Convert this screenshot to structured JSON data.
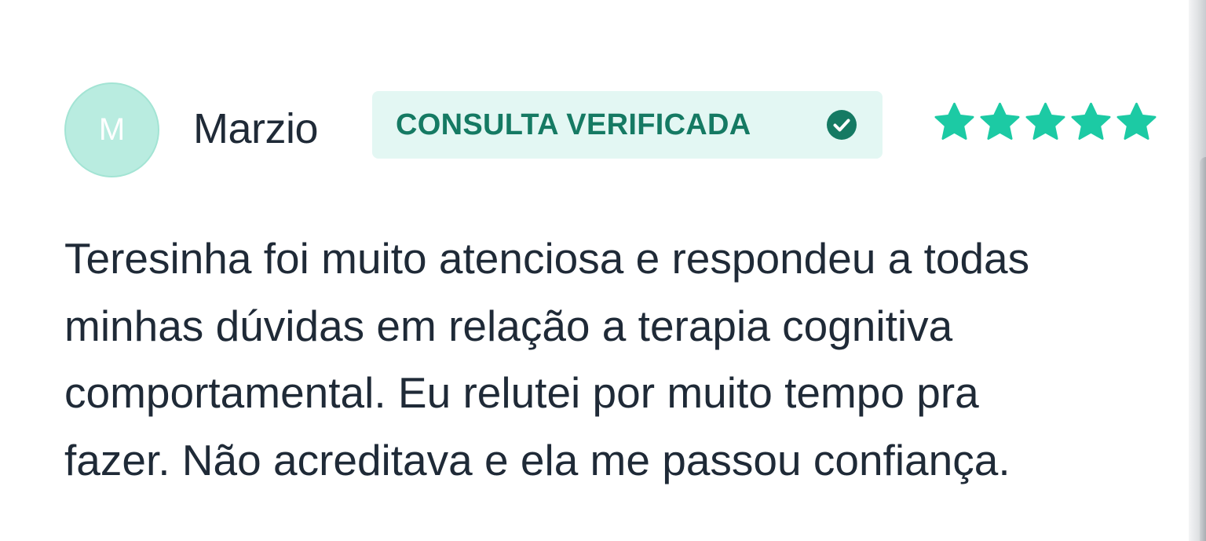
{
  "review": {
    "avatar_initial": "M",
    "author_name": "Marzio",
    "badge_label": "CONSULTA VERIFICADA",
    "rating": 5,
    "rating_max": 5,
    "text": "Teresinha foi muito atenciosa e respondeu a todas\nminhas dúvidas em relação a terapia cognitiva\ncomportamental. Eu relutei por muito tempo pra\nfazer. Não acreditava e ela me passou confiança."
  },
  "colors": {
    "avatar_bg": "#b9ece0",
    "badge_bg": "#e3f7f3",
    "badge_text": "#157a63",
    "star": "#1ccaa4",
    "text": "#1f2a37"
  },
  "icons": {
    "verified": "check-circle-icon",
    "rating": "star-icon"
  }
}
